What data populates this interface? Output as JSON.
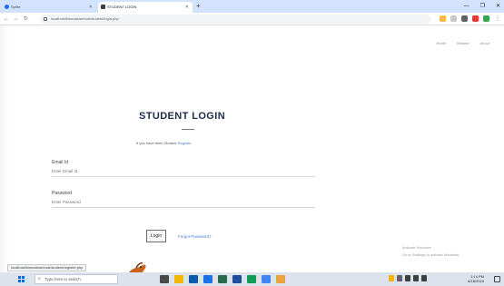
{
  "browser": {
    "tabs": [
      {
        "label": "Sprite",
        "active": false
      },
      {
        "label": "STUDENT LOGIN",
        "active": true
      }
    ],
    "new_tab_label": "+",
    "window_controls": {
      "minimize": "—",
      "maximize": "❐",
      "close": "✕"
    },
    "nav": {
      "back": "←",
      "forward": "→",
      "reload": "↻"
    },
    "url": "localhost/kimnalearnhub/student/login.php",
    "status_url": "localhost/kimnalearnhub/student/register.php"
  },
  "page": {
    "top_nav": [
      "Home",
      "Browse",
      "About"
    ],
    "title": "STUDENT LOGIN",
    "subtitle_prefix": "If you have been Student",
    "subtitle_link": "Register",
    "email": {
      "label": "Email Id",
      "placeholder": "Enter Email Id"
    },
    "password": {
      "label": "Password",
      "placeholder": "Enter Password"
    },
    "login_button": "Login",
    "forgot_link": "Forgot Password?",
    "activation_line1": "Activate Windows",
    "activation_line2": "Go to Settings to activate Windows."
  },
  "taskbar": {
    "search_placeholder": "Type here to search",
    "time": "1:14 PM",
    "date": "6/18/2024"
  },
  "colors": {
    "tab_strip": "#d3e3fd",
    "title": "#1d2d4c",
    "link": "#4b7bd8",
    "taskbar": "#dde3ec",
    "start": "#1468c8"
  },
  "icons": {
    "start": "windows-start-icon",
    "search": "search-icon",
    "lock": "lock-icon",
    "mascot": "mascot-icon"
  }
}
